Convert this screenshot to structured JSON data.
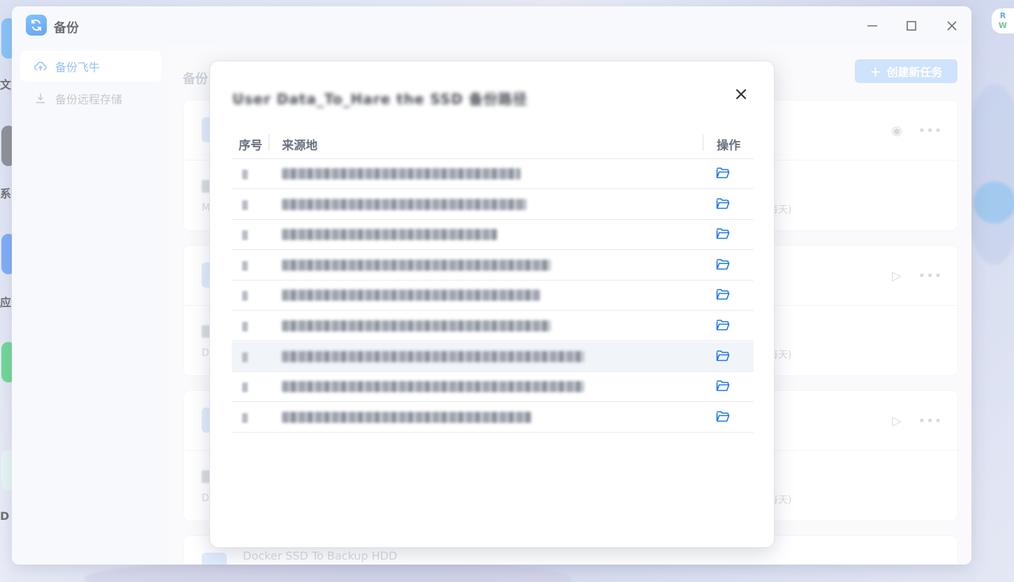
{
  "app": {
    "title": "备份"
  },
  "window_controls": {
    "minimize": "—",
    "maximize": "☐",
    "close": "✕"
  },
  "sidebar": {
    "items": [
      {
        "label": "备份飞牛",
        "icon": "cloud-upload-icon",
        "active": true
      },
      {
        "label": "备份远程存储",
        "icon": "download-icon",
        "active": false
      }
    ]
  },
  "main": {
    "title": "备份",
    "create_button": "创建新任务",
    "tasks": [
      {
        "sub_prefix": "M",
        "schedule_suffix": "每天)"
      },
      {
        "sub_prefix": "D",
        "schedule_suffix": "每天)"
      },
      {
        "sub_prefix": "D",
        "schedule_suffix": "每天)"
      }
    ],
    "peek_title": "Docker SSD To Backup HDD"
  },
  "desktop": {
    "left_labels": [
      "文",
      "系",
      "应",
      "D"
    ],
    "corner_badge": [
      "R",
      "W"
    ]
  },
  "modal": {
    "title": "User Data_To_Hare the SSD 备份路径",
    "columns": {
      "index": "序号",
      "source": "来源地",
      "action": "操作"
    },
    "rows": [
      {
        "index": "1",
        "highlighted": false
      },
      {
        "index": "2",
        "highlighted": false
      },
      {
        "index": "3",
        "highlighted": false
      },
      {
        "index": "4",
        "highlighted": false
      },
      {
        "index": "5",
        "highlighted": false
      },
      {
        "index": "6",
        "highlighted": false
      },
      {
        "index": "7",
        "highlighted": true
      },
      {
        "index": "8",
        "highlighted": false
      },
      {
        "index": "9",
        "highlighted": false
      }
    ]
  },
  "colors": {
    "accent": "#1a73e8",
    "sidebar_active_text": "#5c9df2",
    "create_button_bg": "#b6d4fa",
    "row_highlight": "#f1f4f9"
  }
}
